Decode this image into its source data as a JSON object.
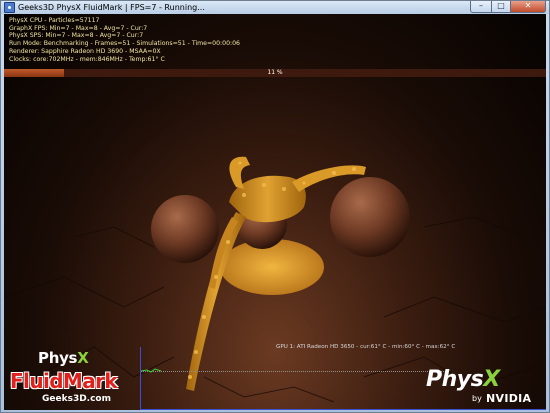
{
  "window": {
    "title": "Geeks3D PhysX FluidMark | FPS=7 - Running...",
    "minimize_icon": "minimize-icon",
    "maximize_icon": "maximize-icon",
    "close_icon": "close-icon",
    "min_glyph": "–",
    "max_glyph": "□",
    "close_glyph": "✕"
  },
  "stats": {
    "line1": "PhysX CPU - Particles=57117",
    "line2": "GraphX FPS: Min=7 - Max=8 - Avg=7 - Cur:7",
    "line3": "PhysX SPS: Min=7 - Max=8 - Avg=7 - Cur:7",
    "line4": "Run Mode: Benchmarking - Frames=51 - Simulations=51 - Time=00:00:06",
    "line5": "Renderer: Sapphire Radeon HD 3690 - MSAA=0X",
    "line6": "Clocks: core:702MHz - mem:846MHz - Temp:61° C"
  },
  "progress": {
    "label": "11 %",
    "fraction": 0.11
  },
  "gpu_info": "GPU 1: ATI Radeon HD 3650 - cur:61° C - min:60° C - max:62° C",
  "branding": {
    "physx_left_prefix": "Phys",
    "physx_left_x": "X",
    "fluidmark": "FluidMark",
    "site": "Geeks3D.com",
    "logo_prefix": "Phys",
    "logo_x": "X",
    "logo_by": "by",
    "logo_nvidia": "NVIDIA"
  },
  "colors": {
    "stats_text": "#f2e6a2",
    "progress_fill": "#c05a2a",
    "fluid": "#d4931e",
    "physx_green": "#8bd13b",
    "fluidmark_red": "#e0201c",
    "graph_axis": "#3b4fd6"
  }
}
